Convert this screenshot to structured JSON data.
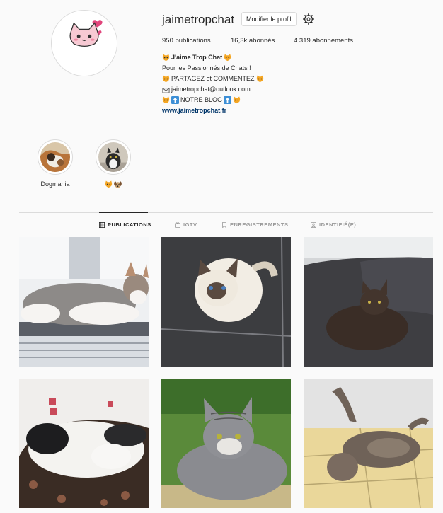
{
  "profile": {
    "username": "jaimetropchat",
    "edit_label": "Modifier le profil",
    "stats": {
      "posts": "950 publications",
      "followers": "16,3k abonnés",
      "following": "4 319 abonnements"
    },
    "avatar_text": "J'aime Trop Chat",
    "bio": {
      "name": "J'aime Trop Chat",
      "line2": "Pour les Passionnés de Chats !",
      "line3": "PARTAGEZ et COMMENTEZ",
      "line4": "jaimetropchat@outlook.com",
      "line5": "NOTRE BLOG",
      "website": "www.jaimetropchat.fr"
    }
  },
  "highlights": [
    {
      "label": "Dogmania"
    },
    {
      "label": ""
    }
  ],
  "tabs": [
    {
      "label": "PUBLICATIONS",
      "icon": "grid-icon",
      "active": true
    },
    {
      "label": "IGTV",
      "icon": "igtv-icon",
      "active": false
    },
    {
      "label": "ENREGISTREMENTS",
      "icon": "bookmark-icon",
      "active": false
    },
    {
      "label": "IDENTIFIÉ(E)",
      "icon": "tag-icon",
      "active": false
    }
  ],
  "colors": {
    "background": "#fafafa",
    "text": "#262626",
    "link": "#003569",
    "muted": "#999999",
    "border": "#dbdbdb"
  }
}
